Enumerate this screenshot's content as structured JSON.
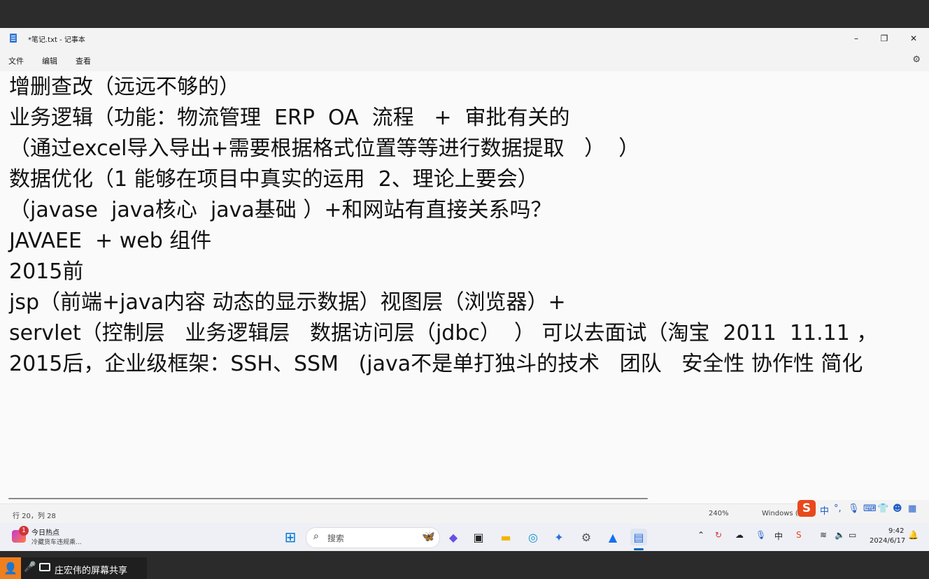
{
  "window": {
    "title": "*笔记.txt - 记事本",
    "minimize": "–",
    "maximize": "❐",
    "close": "✕"
  },
  "menu": {
    "file": "文件",
    "edit": "编辑",
    "view": "查看",
    "settings_icon": "gear-icon"
  },
  "editor": {
    "lines": [
      "增删查改（远远不够的）",
      "业务逻辑（功能：物流管理  ERP  OA  流程   +  审批有关的",
      "（通过excel导入导出+需要根据格式位置等等进行数据提取   ）  ）",
      "数据优化（1 能够在项目中真实的运用  2、理论上要会）",
      "（javase  java核心  java基础 ）+和网站有直接关系吗？",
      "JAVAEE  + web 组件",
      "2015前",
      "jsp（前端+java内容 动态的显示数据）视图层（浏览器）+",
      "servlet（控制层   业务逻辑层   数据访问层（jdbc）  ） 可以去面试（淘宝  2011  11.11 ，",
      "2015后，企业级框架：SSH、SSM   (java不是单打独斗的技术   团队   安全性 协作性 简化"
    ]
  },
  "status": {
    "position": "行 20，列 28",
    "zoom": "240%",
    "line_ending": "Windows (C"
  },
  "ime": {
    "logo": "S",
    "mode": "中",
    "punct": "°,"
  },
  "taskbar": {
    "news_badge": "1",
    "news_title": "今日热点",
    "news_sub": "冷藏货车违规乘...",
    "search_placeholder": "搜索",
    "time": "9:42",
    "date": "2024/6/17"
  },
  "share": {
    "label": "庄宏伟的屏幕共享"
  }
}
